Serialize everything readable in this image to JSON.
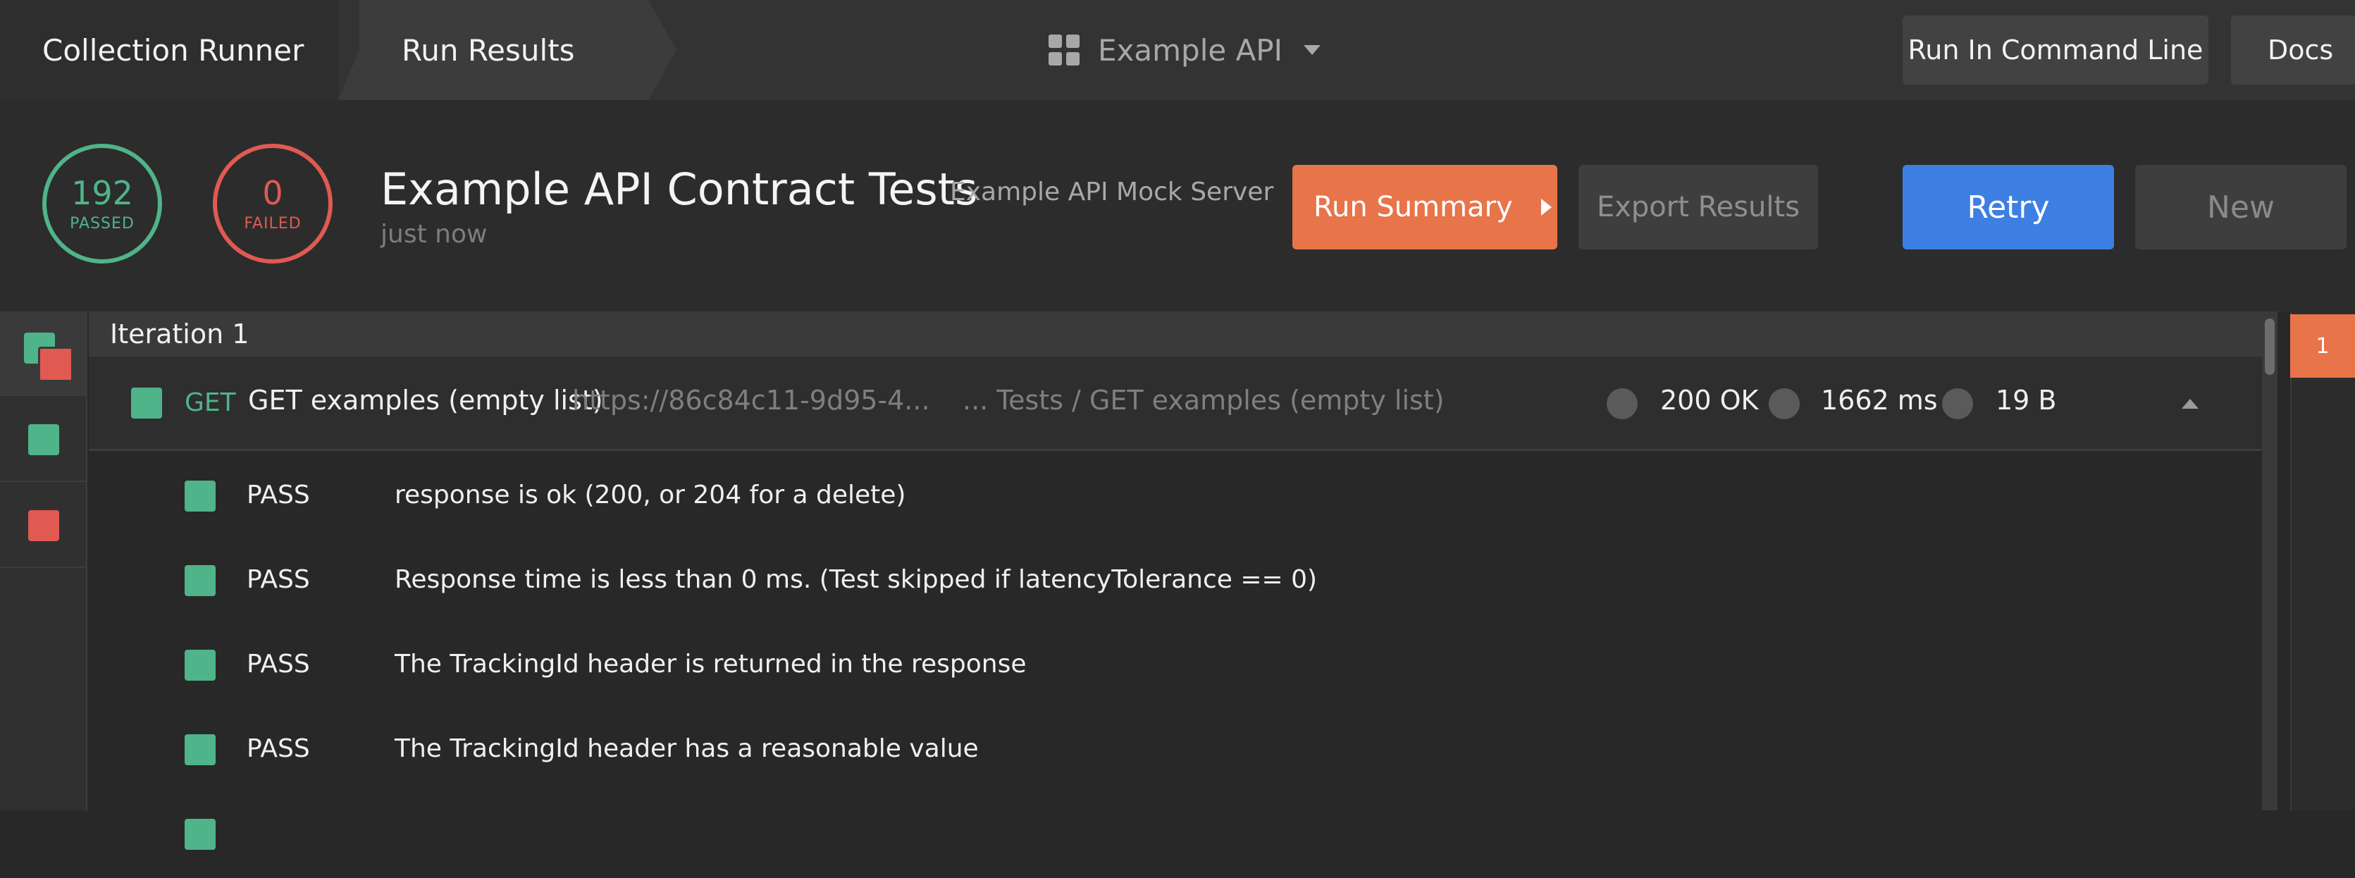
{
  "nav": {
    "crumbs": [
      "Collection Runner",
      "Run Results"
    ],
    "workspace": "Example API",
    "run_cli_label": "Run In Command Line",
    "docs_label": "Docs"
  },
  "summary": {
    "passed_count": "192",
    "passed_label": "PASSED",
    "failed_count": "0",
    "failed_label": "FAILED",
    "title": "Example API Contract Tests",
    "environment": "Example API Mock Server",
    "time": "just now",
    "run_summary_label": "Run Summary",
    "export_label": "Export Results",
    "retry_label": "Retry",
    "new_label": "New"
  },
  "iteration": {
    "label": "Iteration 1",
    "chip": "1"
  },
  "request": {
    "method": "GET",
    "name": "GET examples (empty list)",
    "url": "https://86c84c11-9d95-4...",
    "path": "... Tests / GET examples (empty list)",
    "status": "200 OK",
    "duration": "1662 ms",
    "size": "19 B"
  },
  "tests": [
    {
      "result": "PASS",
      "description": "response is ok (200, or 204 for a delete)"
    },
    {
      "result": "PASS",
      "description": "Response time is less than 0 ms. (Test skipped if latencyTolerance == 0)"
    },
    {
      "result": "PASS",
      "description": "The TrackingId header is returned in the response"
    },
    {
      "result": "PASS",
      "description": "The TrackingId header has a reasonable value"
    }
  ],
  "colors": {
    "pass": "#4fb489",
    "fail": "#e05a52",
    "accent_orange": "#e8744a",
    "accent_blue": "#3d7fe3"
  },
  "icons": [
    "workspace-grid-icon",
    "chevron-down-icon",
    "play-icon",
    "collapse-icon",
    "status-square-icon"
  ]
}
